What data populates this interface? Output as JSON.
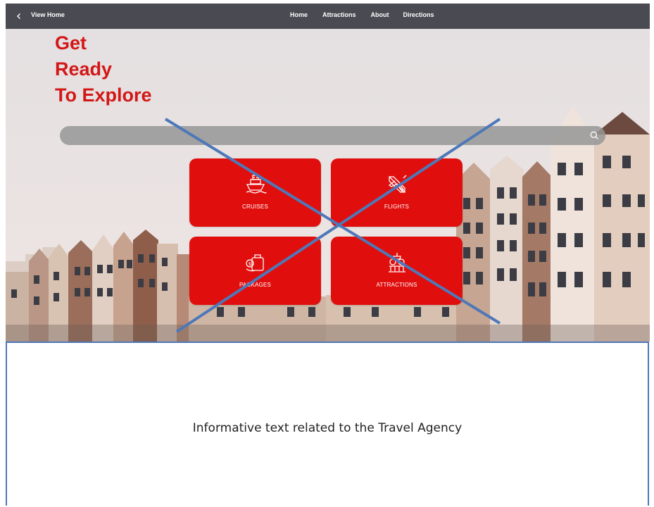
{
  "topbar": {
    "back_icon": "chevron-left-icon",
    "title": "View Home",
    "nav": [
      "Home",
      "Attractions",
      "About",
      "Directions"
    ]
  },
  "hero": {
    "headline": [
      "Get",
      "Ready",
      "To Explore"
    ],
    "search": {
      "placeholder": "",
      "icon": "search-icon"
    },
    "tiles": [
      {
        "label": "CRUISES",
        "icon": "ship-icon"
      },
      {
        "label": "FLIGHTS",
        "icon": "airplane-icon"
      },
      {
        "label": "PACKAGES",
        "icon": "luggage-icon"
      },
      {
        "label": "ATTRACTIONS",
        "icon": "sightseeing-icon"
      }
    ]
  },
  "info": {
    "text": "Informative text related to the Travel Agency"
  },
  "colors": {
    "accent": "#d31717",
    "tile": "#e10e0e",
    "topbar": "#4a4a52",
    "cross": "#4e78b8"
  }
}
